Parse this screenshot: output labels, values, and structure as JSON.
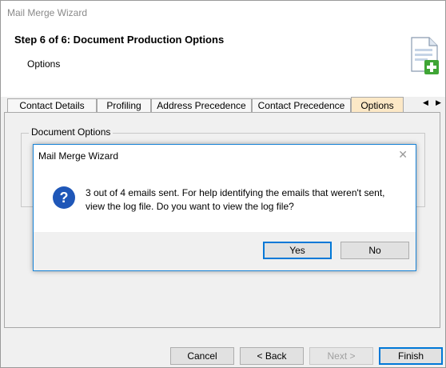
{
  "window": {
    "title": "Mail Merge Wizard"
  },
  "header": {
    "step_title": "Step 6 of 6: Document Production Options",
    "subtitle": "Options"
  },
  "tabs": [
    {
      "label": "Contact Details"
    },
    {
      "label": "Profiling"
    },
    {
      "label": "Address Precedence"
    },
    {
      "label": "Contact Precedence"
    },
    {
      "label": "Options",
      "active": true
    }
  ],
  "group": {
    "label": "Document Options"
  },
  "buttons": {
    "cancel": "Cancel",
    "back": "< Back",
    "next": "Next >",
    "finish": "Finish"
  },
  "dialog": {
    "title": "Mail Merge Wizard",
    "message": "3 out of 4 emails sent. For help identifying the emails that weren't sent, view the log file. Do you want to view the log file?",
    "yes": "Yes",
    "no": "No"
  }
}
